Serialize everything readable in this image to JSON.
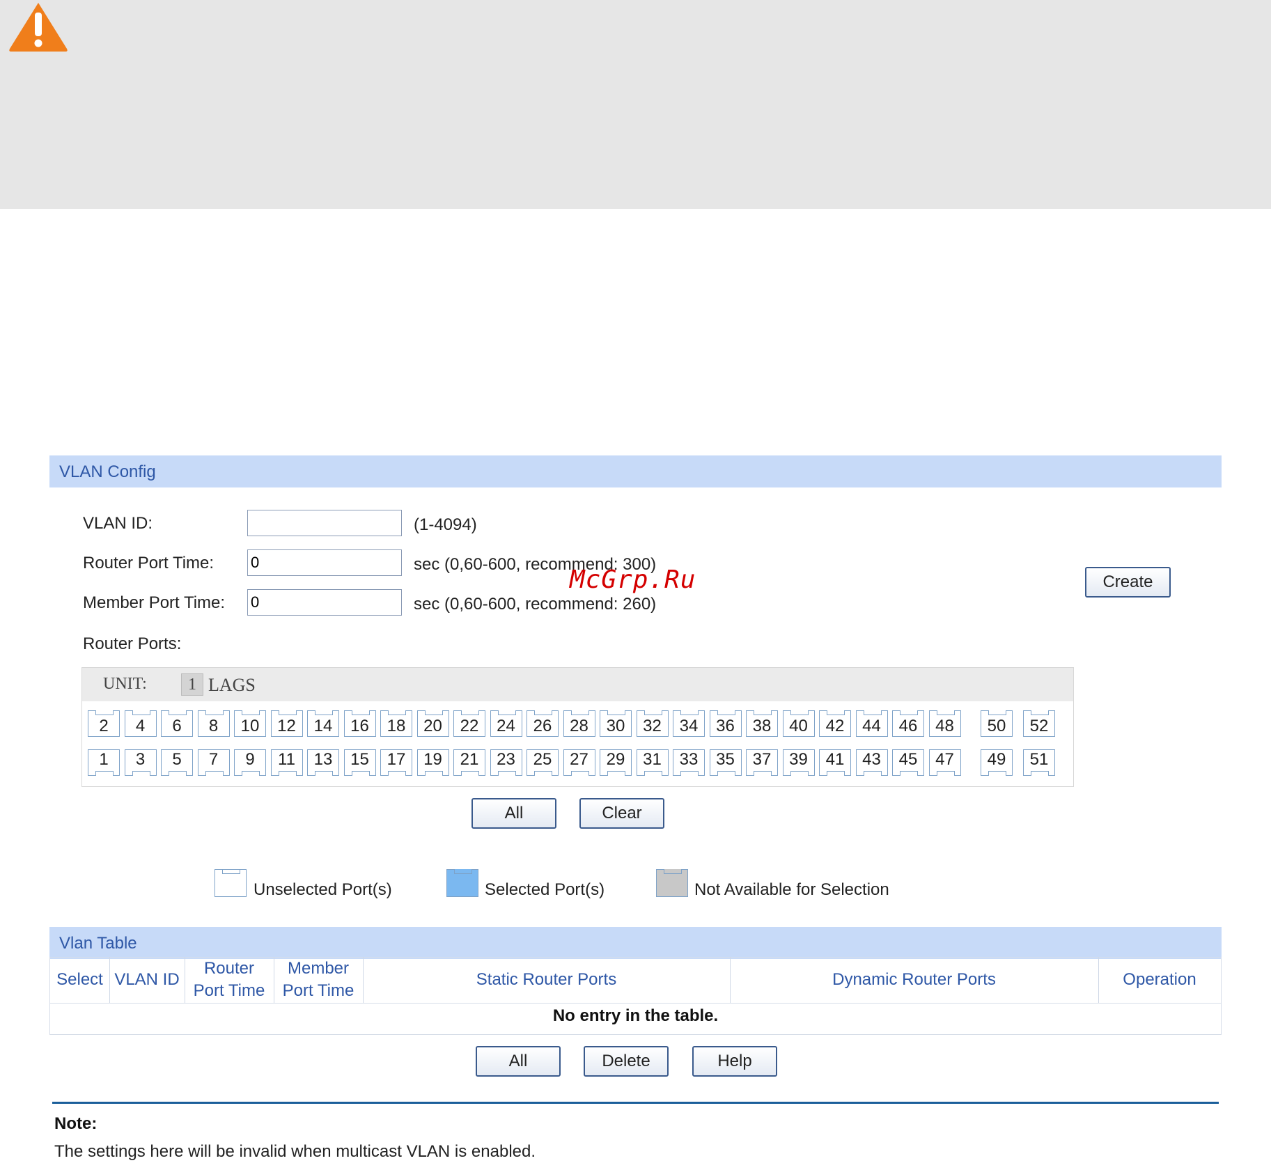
{
  "watermark": "McGrp.Ru",
  "vlan_config": {
    "header": "VLAN Config",
    "vlan_id_label": "VLAN ID:",
    "vlan_id_value": "",
    "vlan_id_hint": "(1-4094)",
    "router_port_time_label": "Router Port Time:",
    "router_port_time_value": "0",
    "router_port_time_hint": "sec (0,60-600, recommend: 300)",
    "member_port_time_label": "Member Port Time:",
    "member_port_time_value": "0",
    "member_port_time_hint": "sec (0,60-600, recommend: 260)",
    "create_label": "Create",
    "router_ports_label": "Router Ports:"
  },
  "ports_panel": {
    "unit_label": "UNIT:",
    "unit_value": "1",
    "lags_label": "LAGS",
    "top_row": [
      "2",
      "4",
      "6",
      "8",
      "10",
      "12",
      "14",
      "16",
      "18",
      "20",
      "22",
      "24",
      "26",
      "28",
      "30",
      "32",
      "34",
      "36",
      "38",
      "40",
      "42",
      "44",
      "46",
      "48",
      "50",
      "52"
    ],
    "bottom_row": [
      "1",
      "3",
      "5",
      "7",
      "9",
      "11",
      "13",
      "15",
      "17",
      "19",
      "21",
      "23",
      "25",
      "27",
      "29",
      "31",
      "33",
      "35",
      "37",
      "39",
      "41",
      "43",
      "45",
      "47",
      "49",
      "51"
    ],
    "all_label": "All",
    "clear_label": "Clear"
  },
  "legend": {
    "unselected": "Unselected Port(s)",
    "selected": "Selected Port(s)",
    "not_available": "Not Available for Selection",
    "colors": {
      "unselected": "#ffffff",
      "selected": "#7bb8f0",
      "not_available": "#c8c8c8"
    }
  },
  "vlan_table": {
    "header": "Vlan Table",
    "columns": {
      "select": "Select",
      "vlan_id": "VLAN ID",
      "router_port_time_1": "Router",
      "router_port_time_2": "Port Time",
      "member_port_time_1": "Member",
      "member_port_time_2": "Port Time",
      "static_router_ports": "Static Router Ports",
      "dynamic_router_ports": "Dynamic Router Ports",
      "operation": "Operation"
    },
    "empty_message": "No entry in the table.",
    "all_label": "All",
    "delete_label": "Delete",
    "help_label": "Help"
  },
  "note": {
    "title": "Note:",
    "text": "The settings here will be invalid when multicast VLAN is enabled."
  },
  "colors": {
    "accent": "#2e57a6",
    "header_bg": "#c7daf8",
    "warning": "#f07e1b"
  }
}
